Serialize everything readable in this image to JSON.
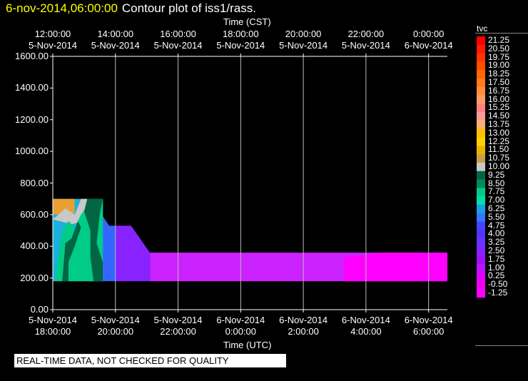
{
  "header": {
    "timestamp": "6-nov-2014,06:00:00",
    "title": "Contour plot of iss1/rass."
  },
  "qc_note": "REAL-TIME DATA, NOT CHECKED FOR QUALITY",
  "chart_data": {
    "type": "heatmap",
    "top_axis": {
      "title": "Time (CST)",
      "ticks": [
        {
          "time": "12:00:00",
          "date": "5-Nov-2014"
        },
        {
          "time": "14:00:00",
          "date": "5-Nov-2014"
        },
        {
          "time": "16:00:00",
          "date": "5-Nov-2014"
        },
        {
          "time": "18:00:00",
          "date": "5-Nov-2014"
        },
        {
          "time": "20:00:00",
          "date": "5-Nov-2014"
        },
        {
          "time": "22:00:00",
          "date": "5-Nov-2014"
        },
        {
          "time": "0:00:00",
          "date": "6-Nov-2014"
        }
      ]
    },
    "bottom_axis": {
      "title": "Time (UTC)",
      "ticks": [
        {
          "date": "5-Nov-2014",
          "time": "18:00:00"
        },
        {
          "date": "5-Nov-2014",
          "time": "20:00:00"
        },
        {
          "date": "5-Nov-2014",
          "time": "22:00:00"
        },
        {
          "date": "6-Nov-2014",
          "time": "0:00:00"
        },
        {
          "date": "6-Nov-2014",
          "time": "2:00:00"
        },
        {
          "date": "6-Nov-2014",
          "time": "4:00:00"
        },
        {
          "date": "6-Nov-2014",
          "time": "6:00:00"
        }
      ],
      "range_hours_utc": [
        18.0,
        30.6
      ]
    },
    "y_axis": {
      "ticks": [
        "0.00",
        "200.00",
        "400.00",
        "600.00",
        "800.00",
        "1000.00",
        "1200.00",
        "1400.00",
        "1600.00"
      ],
      "ylim": [
        0,
        1600
      ]
    },
    "grid": true,
    "colorbar": {
      "title": "tvc",
      "labels": [
        "21.25",
        "20.50",
        "19.75",
        "19.00",
        "18.25",
        "17.50",
        "16.75",
        "16.00",
        "15.25",
        "14.50",
        "13.75",
        "13.00",
        "12.25",
        "11.50",
        "10.75",
        "10.00",
        "9.25",
        "8.50",
        "7.75",
        "7.00",
        "6.25",
        "5.50",
        "4.75",
        "4.00",
        "3.25",
        "2.50",
        "1.75",
        "1.00",
        "0.25",
        "-0.50",
        "-1.25"
      ],
      "colors": [
        "#ff0000",
        "#ff1a00",
        "#ff3300",
        "#ff4d00",
        "#ff6600",
        "#ff7a1a",
        "#ff8c3a",
        "#ff9a66",
        "#ff8080",
        "#ff9999",
        "#ffb070",
        "#ffc000",
        "#ffd000",
        "#e8b400",
        "#c8a040",
        "#c8c8c8",
        "#006644",
        "#008a5a",
        "#00cc88",
        "#00ddaa",
        "#1a9fe0",
        "#3377ff",
        "#4444ff",
        "#5533ff",
        "#6633ff",
        "#8822ff",
        "#9911ff",
        "#bb11ff",
        "#dd00ff",
        "#ee00ee",
        "#ff00ff"
      ]
    },
    "regions": [
      {
        "name": "lower-block-magenta",
        "color": "#cc22ff",
        "polygon": [
          [
            21.1,
            180
          ],
          [
            21.1,
            360
          ],
          [
            30.6,
            360
          ],
          [
            30.6,
            180
          ]
        ]
      },
      {
        "name": "lower-block-pink",
        "color": "#ff00ff",
        "polygon": [
          [
            27.3,
            180
          ],
          [
            27.3,
            330
          ],
          [
            28.5,
            360
          ],
          [
            30.6,
            360
          ],
          [
            30.6,
            180
          ]
        ]
      },
      {
        "name": "middle-ramp-purple",
        "color": "#8822ff",
        "polygon": [
          [
            20.0,
            180
          ],
          [
            20.0,
            530
          ],
          [
            20.5,
            530
          ],
          [
            21.1,
            360
          ],
          [
            21.1,
            180
          ]
        ]
      },
      {
        "name": "middle-blue",
        "color": "#3366ff",
        "polygon": [
          [
            19.0,
            180
          ],
          [
            19.0,
            700
          ],
          [
            19.5,
            620
          ],
          [
            19.8,
            530
          ],
          [
            20.0,
            530
          ],
          [
            20.0,
            180
          ]
        ]
      },
      {
        "name": "left-cyan",
        "color": "#1ab0e0",
        "polygon": [
          [
            18.0,
            180
          ],
          [
            18.0,
            700
          ],
          [
            19.6,
            700
          ],
          [
            19.6,
            180
          ]
        ]
      },
      {
        "name": "left-orange",
        "color": "#e8a030",
        "polygon": [
          [
            18.0,
            600
          ],
          [
            18.0,
            700
          ],
          [
            18.7,
            700
          ],
          [
            18.7,
            610
          ]
        ]
      },
      {
        "name": "left-gray",
        "color": "#c8c8c8",
        "polygon": [
          [
            18.0,
            570
          ],
          [
            18.4,
            640
          ],
          [
            18.7,
            600
          ],
          [
            18.9,
            700
          ],
          [
            19.1,
            700
          ],
          [
            19.0,
            560
          ],
          [
            18.6,
            540
          ]
        ]
      },
      {
        "name": "left-green-band",
        "color": "#00cc88",
        "polygon": [
          [
            18.1,
            250
          ],
          [
            18.3,
            500
          ],
          [
            18.5,
            560
          ],
          [
            18.7,
            520
          ],
          [
            18.9,
            600
          ],
          [
            19.2,
            680
          ],
          [
            19.6,
            700
          ],
          [
            19.6,
            180
          ],
          [
            18.1,
            180
          ]
        ]
      },
      {
        "name": "center-darkgreen",
        "color": "#006644",
        "polygon": [
          [
            19.1,
            700
          ],
          [
            19.6,
            700
          ],
          [
            19.5,
            600
          ],
          [
            19.4,
            420
          ],
          [
            19.6,
            300
          ],
          [
            19.6,
            180
          ],
          [
            19.3,
            180
          ],
          [
            19.2,
            330
          ],
          [
            19.2,
            500
          ],
          [
            19.0,
            620
          ]
        ]
      },
      {
        "name": "center-left-darkgreen",
        "color": "#006644",
        "polygon": [
          [
            18.3,
            180
          ],
          [
            18.4,
            420
          ],
          [
            18.6,
            450
          ],
          [
            18.8,
            560
          ],
          [
            18.9,
            520
          ],
          [
            18.7,
            400
          ],
          [
            18.5,
            300
          ],
          [
            18.5,
            180
          ]
        ]
      }
    ]
  }
}
